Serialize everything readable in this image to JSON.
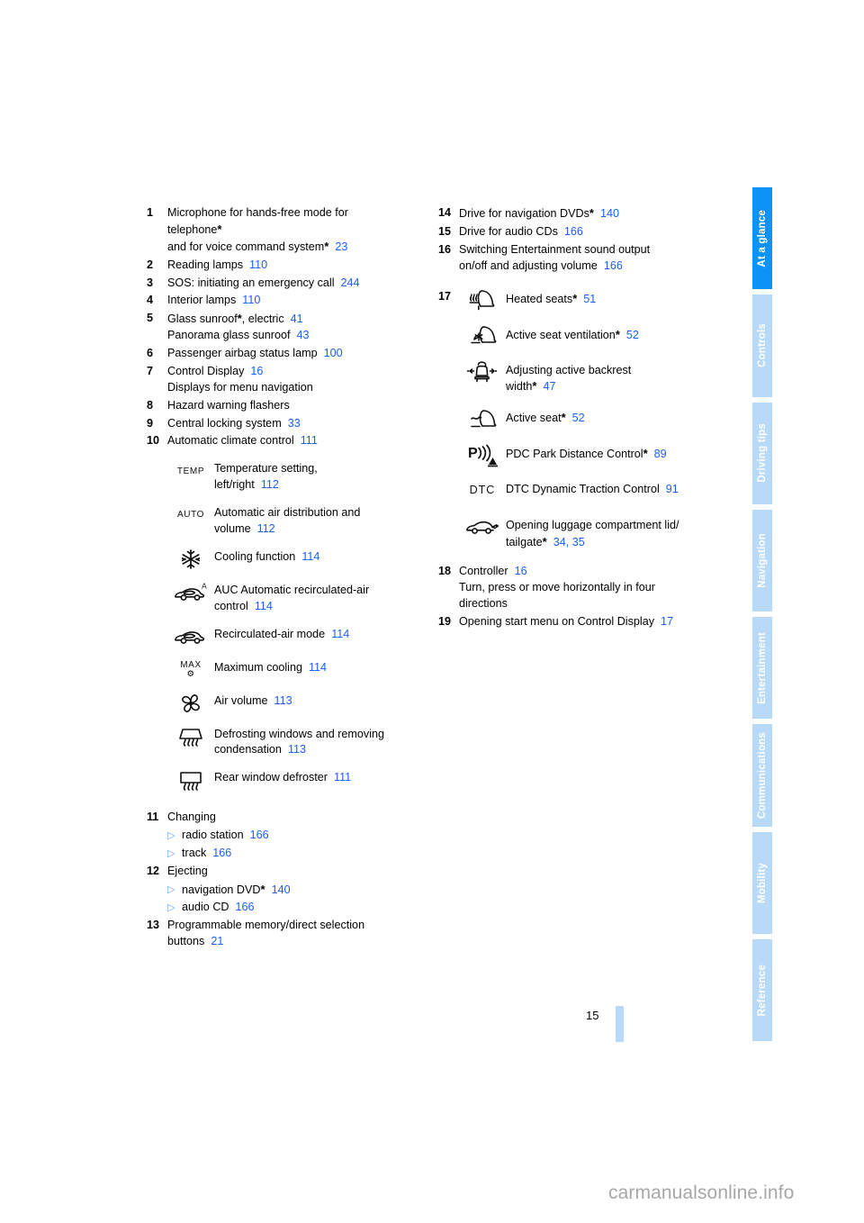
{
  "document": {
    "page_number": "15",
    "watermark": "carmanualsonline.info"
  },
  "sidebar": {
    "tabs": [
      {
        "label": "At a glance",
        "active": true
      },
      {
        "label": "Controls",
        "active": false
      },
      {
        "label": "Driving tips",
        "active": false
      },
      {
        "label": "Navigation",
        "active": false
      },
      {
        "label": "Entertainment",
        "active": false
      },
      {
        "label": "Communications",
        "active": false
      },
      {
        "label": "Mobility",
        "active": false
      },
      {
        "label": "Reference",
        "active": false
      }
    ],
    "active_color": "#0d92f5",
    "inactive_color": "#b8daf8"
  },
  "colors": {
    "page_ref_blue": "#1a5ff5",
    "bullet_blue": "#5aa9f7",
    "text_black": "#000000"
  },
  "left_column": {
    "items": [
      {
        "num": "1",
        "lines": [
          {
            "text": "Microphone for hands-free mode for"
          },
          {
            "text": "telephone",
            "star": true
          },
          {
            "text": "and for voice command system",
            "star": true,
            "page": "23"
          }
        ]
      },
      {
        "num": "2",
        "lines": [
          {
            "text": "Reading lamps",
            "page": "110"
          }
        ]
      },
      {
        "num": "3",
        "lines": [
          {
            "text": "SOS: initiating an emergency call",
            "page": "244"
          }
        ]
      },
      {
        "num": "4",
        "lines": [
          {
            "text": "Interior lamps",
            "page": "110"
          }
        ]
      },
      {
        "num": "5",
        "lines": [
          {
            "text": "Glass sunroof",
            "star": true,
            "suffix": ", electric",
            "page": "41"
          },
          {
            "text": "Panorama glass sunroof",
            "page": "43"
          }
        ]
      },
      {
        "num": "6",
        "lines": [
          {
            "text": "Passenger airbag status lamp",
            "page": "100"
          }
        ]
      },
      {
        "num": "7",
        "lines": [
          {
            "text": "Control Display",
            "page": "16"
          },
          {
            "text": "Displays for menu navigation"
          }
        ]
      },
      {
        "num": "8",
        "lines": [
          {
            "text": "Hazard warning flashers"
          }
        ]
      },
      {
        "num": "9",
        "lines": [
          {
            "text": "Central locking system",
            "page": "33"
          }
        ]
      },
      {
        "num": "10",
        "lines": [
          {
            "text": "Automatic climate control",
            "page": "111"
          }
        ]
      }
    ],
    "climate_icons": [
      {
        "icon": "temp-text-icon",
        "glyph": "TEMP",
        "lines": [
          {
            "text": "Temperature setting,"
          },
          {
            "text": "left/right",
            "page": "112"
          }
        ]
      },
      {
        "icon": "auto-text-icon",
        "glyph": "AUTO",
        "lines": [
          {
            "text": "Automatic air distribution and"
          },
          {
            "text": "volume",
            "page": "112"
          }
        ]
      },
      {
        "icon": "snowflake-icon",
        "glyph": "",
        "lines": [
          {
            "text": "Cooling function",
            "page": "114"
          }
        ]
      },
      {
        "icon": "auc-car-recirculation-icon",
        "glyph": "",
        "lines": [
          {
            "text": "AUC Automatic recirculated-air"
          },
          {
            "text": "control",
            "page": "114"
          }
        ]
      },
      {
        "icon": "car-recirculation-icon",
        "glyph": "",
        "lines": [
          {
            "text": "Recirculated-air mode",
            "page": "114"
          }
        ]
      },
      {
        "icon": "max-cooling-icon",
        "glyph": "MAX",
        "lines": [
          {
            "text": "Maximum cooling",
            "page": "114"
          }
        ]
      },
      {
        "icon": "fan-icon",
        "glyph": "",
        "lines": [
          {
            "text": "Air volume",
            "page": "113"
          }
        ]
      },
      {
        "icon": "windshield-defrost-icon",
        "glyph": "",
        "lines": [
          {
            "text": "Defrosting windows and removing"
          },
          {
            "text": "condensation",
            "page": "113"
          }
        ]
      },
      {
        "icon": "rear-window-defrost-icon",
        "glyph": "",
        "lines": [
          {
            "text": "Rear window defroster",
            "page": "111"
          }
        ]
      }
    ],
    "items_tail": [
      {
        "num": "11",
        "lines": [
          {
            "text": "Changing"
          }
        ],
        "subs": [
          {
            "text": "radio station",
            "page": "166"
          },
          {
            "text": "track",
            "page": "166"
          }
        ]
      },
      {
        "num": "12",
        "lines": [
          {
            "text": "Ejecting"
          }
        ],
        "subs": [
          {
            "text": "navigation DVD",
            "star": true,
            "page": "140"
          },
          {
            "text": "audio CD",
            "page": "166"
          }
        ]
      },
      {
        "num": "13",
        "lines": [
          {
            "text": "Programmable memory/direct selection"
          },
          {
            "text": "buttons",
            "page": "21"
          }
        ]
      }
    ]
  },
  "right_column": {
    "items_head": [
      {
        "num": "14",
        "lines": [
          {
            "text": "Drive for navigation DVDs",
            "star": true,
            "page": "140"
          }
        ]
      },
      {
        "num": "15",
        "lines": [
          {
            "text": "Drive for audio CDs",
            "page": "166"
          }
        ]
      },
      {
        "num": "16",
        "lines": [
          {
            "text": "Switching Entertainment sound output"
          },
          {
            "text": "on/off and adjusting volume",
            "page": "166"
          }
        ]
      }
    ],
    "item17": {
      "num": "17",
      "icons": [
        {
          "icon": "heated-seat-icon",
          "glyph": "",
          "lines": [
            {
              "text": "Heated seats",
              "star": true,
              "page": "51"
            }
          ]
        },
        {
          "icon": "seat-ventilation-icon",
          "glyph": "",
          "lines": [
            {
              "text": "Active seat ventilation",
              "star": true,
              "page": "52"
            }
          ]
        },
        {
          "icon": "backrest-width-icon",
          "glyph": "",
          "lines": [
            {
              "text": "Adjusting active backrest"
            },
            {
              "text": "width",
              "star": true,
              "page": "47"
            }
          ]
        },
        {
          "icon": "active-seat-icon",
          "glyph": "",
          "lines": [
            {
              "text": "Active seat",
              "star": true,
              "page": "52"
            }
          ]
        },
        {
          "icon": "pdc-icon",
          "glyph": "",
          "lines": [
            {
              "text": "PDC Park Distance Control",
              "star": true,
              "page": "89"
            }
          ]
        },
        {
          "icon": "dtc-text-icon",
          "glyph": "DTC",
          "lines": [
            {
              "text": "DTC Dynamic Traction Control",
              "page": "91"
            }
          ]
        },
        {
          "icon": "trunk-lid-icon",
          "glyph": "",
          "lines": [
            {
              "text": "Opening luggage compartment lid/"
            },
            {
              "text": "tailgate",
              "star": true,
              "page": "34, 35"
            }
          ]
        }
      ]
    },
    "items_tail": [
      {
        "num": "18",
        "lines": [
          {
            "text": "Controller",
            "page": "16"
          },
          {
            "text": "Turn, press or move horizontally in four"
          },
          {
            "text": "directions"
          }
        ]
      },
      {
        "num": "19",
        "lines": [
          {
            "text": "Opening start menu on Control Display",
            "page": "17"
          }
        ]
      }
    ]
  }
}
